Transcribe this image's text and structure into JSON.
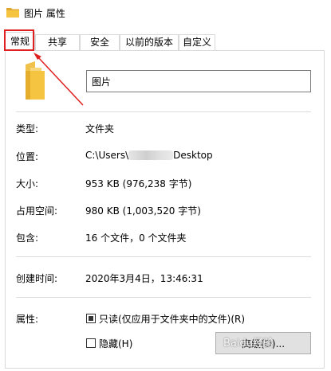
{
  "window": {
    "title": "图片 属性",
    "icon": "folder-icon"
  },
  "tabs": [
    {
      "label": "常规",
      "active": true
    },
    {
      "label": "共享",
      "active": false
    },
    {
      "label": "安全",
      "active": false
    },
    {
      "label": "以前的版本",
      "active": false
    },
    {
      "label": "自定义",
      "active": false
    }
  ],
  "general": {
    "folder_name": "图片",
    "type_label": "类型:",
    "type_value": "文件夹",
    "location_label": "位置:",
    "location_prefix": "C:\\Users\\",
    "location_suffix": "Desktop",
    "size_label": "大小:",
    "size_value": "953 KB (976,238 字节)",
    "size_on_disk_label": "占用空间:",
    "size_on_disk_value": "980 KB (1,003,520 字节)",
    "contains_label": "包含:",
    "contains_value": "16 个文件，0 个文件夹",
    "created_label": "创建时间:",
    "created_value": "2020年3月4日，13:46:31",
    "attributes_label": "属性:",
    "readonly_label": "只读(仅应用于文件夹中的文件)(R)",
    "readonly_checked": true,
    "hidden_label": "隐藏(H)",
    "hidden_checked": false,
    "advanced_button": "高级(D)..."
  },
  "colors": {
    "folder_yellow": "#f5c542",
    "annotation_red": "#e02020"
  },
  "watermark": "Baidu经验"
}
